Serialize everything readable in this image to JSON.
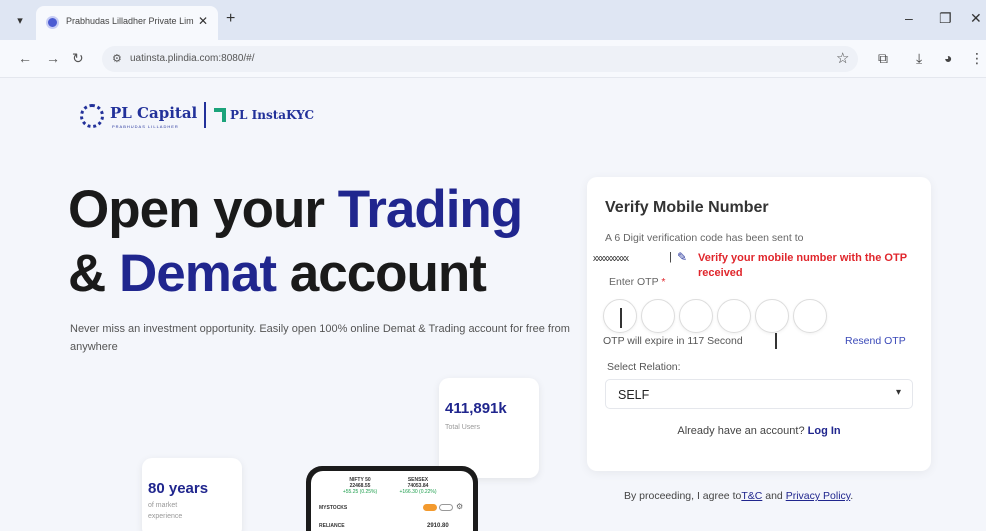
{
  "browser": {
    "tab_title": "Prabhudas Lilladher Private Lim",
    "url": "uatinsta.plindia.com:8080/#/"
  },
  "logo": {
    "brand": "PL Capital",
    "brand_sub": "PRABHUDAS LILLADHER",
    "product": "PL InstaKYC"
  },
  "hero": {
    "line1_plain": "Open your ",
    "line1_accent": "Trading",
    "line2_prefix": "& ",
    "line2_accent": "Demat",
    "line2_suffix": " account",
    "subtitle": "Never miss an investment opportunity. Easily open 100% online Demat & Trading account for free from anywhere"
  },
  "stats": {
    "users_value": "411,891k",
    "users_label": "Total Users",
    "years_value": "80 years",
    "years_label": "of market experience"
  },
  "phone": {
    "nifty_name": "NIFTY 50",
    "nifty_value": "22468.55",
    "nifty_change": "+55.25 (0.25%)",
    "sensex_name": "SENSEX",
    "sensex_value": "74053.84",
    "sensex_change": "+166.30 (0.22%)",
    "watchlist": "MYSTOCKS",
    "row_name": "RELIANCE",
    "row_value": "2910.80"
  },
  "form": {
    "title": "Verify Mobile Number",
    "description": "A 6 Digit verification code has been sent to",
    "masked_mobile": "xxxxxxxxxx",
    "annotation": "Verify your mobile number with the OTP received",
    "otp_label": "Enter OTP",
    "otp_required": "*",
    "otp_boxes": [
      "",
      "",
      "",
      "",
      "",
      ""
    ],
    "timer_text": "OTP will expire in 117 Second",
    "resend": "Resend OTP",
    "relation_label": "Select Relation:",
    "relation_value": "SELF",
    "login_prompt": "Already have an account?",
    "login_link": "Log In"
  },
  "terms": {
    "prefix": "By proceeding, I agree to",
    "tc": "T&C",
    "and": " and ",
    "privacy": "Privacy Policy"
  },
  "colors": {
    "brand_blue": "#20268e",
    "annotation_red": "#e0262c",
    "kyc_green": "#1ba37a"
  }
}
